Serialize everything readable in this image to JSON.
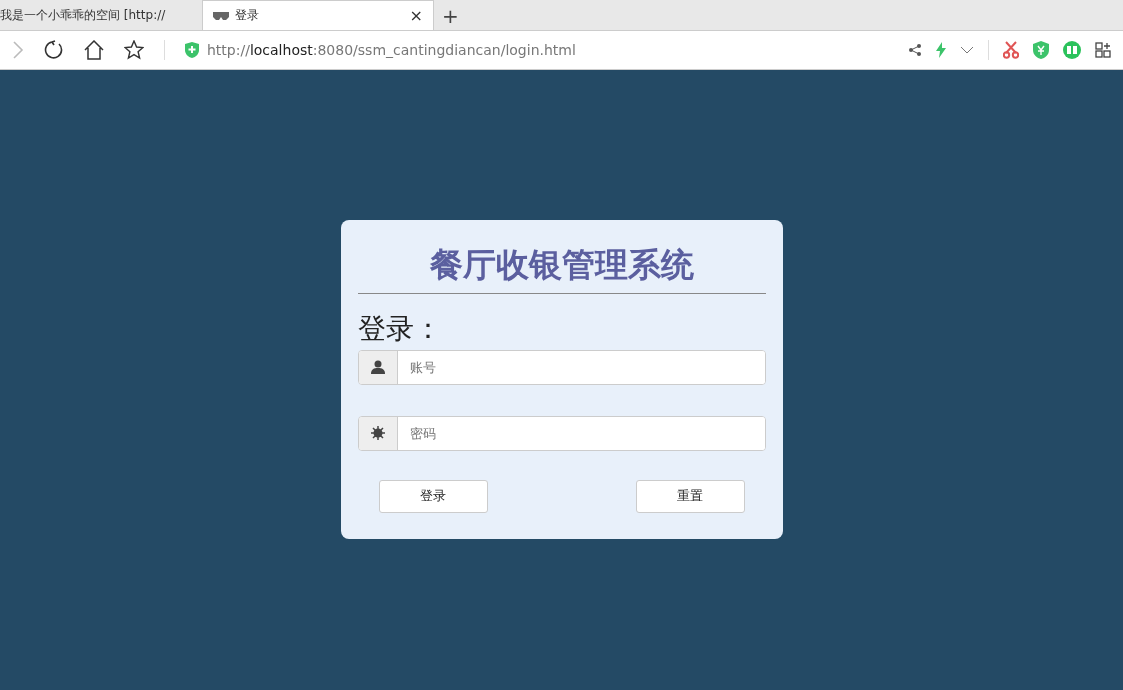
{
  "tabs": [
    {
      "label": "我是一个小乖乖的空间 [http://",
      "selected": false
    },
    {
      "label": "登录",
      "selected": true,
      "close": "×"
    }
  ],
  "new_tab": "+",
  "address_bar": {
    "url": "http://**localhost**:8080/ssm_cantingdiancan/login.html"
  },
  "login": {
    "title": "餐厅收银管理系统",
    "heading": "登录：",
    "fields": [
      {
        "kind": "user",
        "placeholder": "账号"
      },
      {
        "kind": "password",
        "placeholder": "密码"
      }
    ],
    "buttons": [
      "登录",
      "重置"
    ]
  }
}
